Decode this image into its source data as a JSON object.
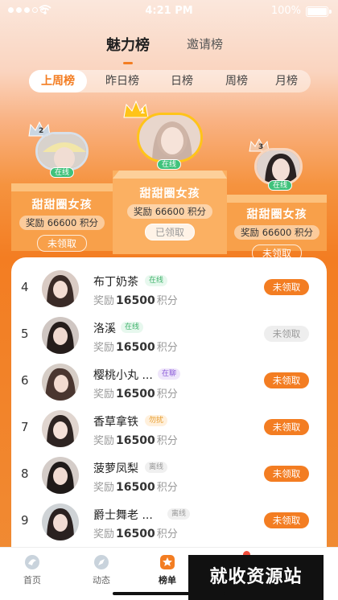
{
  "status_bar": {
    "time": "4:21 PM",
    "battery": "100%"
  },
  "top_tabs": [
    {
      "label": "魅力榜"
    },
    {
      "label": "邀请榜"
    }
  ],
  "period_tabs": [
    {
      "label": "上周榜"
    },
    {
      "label": "昨日榜"
    },
    {
      "label": "日榜"
    },
    {
      "label": "周榜"
    },
    {
      "label": "月榜"
    }
  ],
  "podium": {
    "first": {
      "rank": "1",
      "status": "在线",
      "name": "甜甜圈女孩",
      "reward": "奖励 66600 积分",
      "button": "已领取"
    },
    "second": {
      "rank": "2",
      "status": "在线",
      "name": "甜甜圈女孩",
      "reward": "奖励 66600 积分",
      "button": "未领取"
    },
    "third": {
      "rank": "3",
      "status": "在线",
      "name": "甜甜圈女孩",
      "reward": "奖励 66600 积分",
      "button": "未领取"
    }
  },
  "list": [
    {
      "rank": "4",
      "name": "布丁奶茶",
      "status": "在线",
      "status_type": "online",
      "reward_prefix": "奖励",
      "reward_value": "16500",
      "reward_unit": "积分",
      "button": "未领取",
      "claimed": false
    },
    {
      "rank": "5",
      "name": "洛溪",
      "status": "在线",
      "status_type": "online",
      "reward_prefix": "奖励",
      "reward_value": "16500",
      "reward_unit": "积分",
      "button": "未领取",
      "claimed": true
    },
    {
      "rank": "6",
      "name": "樱桃小丸 ...",
      "status": "在聊",
      "status_type": "room",
      "reward_prefix": "奖励",
      "reward_value": "16500",
      "reward_unit": "积分",
      "button": "未领取",
      "claimed": false
    },
    {
      "rank": "7",
      "name": "香草拿铁",
      "status": "勿扰",
      "status_type": "busy",
      "reward_prefix": "奖励",
      "reward_value": "16500",
      "reward_unit": "积分",
      "button": "未领取",
      "claimed": false
    },
    {
      "rank": "8",
      "name": "菠萝凤梨",
      "status": "离线",
      "status_type": "off",
      "reward_prefix": "奖励",
      "reward_value": "16500",
      "reward_unit": "积分",
      "button": "未领取",
      "claimed": false
    },
    {
      "rank": "9",
      "name": "爵士舞老 ...",
      "status": "离线",
      "status_type": "off",
      "reward_prefix": "奖励",
      "reward_value": "16500",
      "reward_unit": "积分",
      "button": "未领取",
      "claimed": false
    }
  ],
  "bottom_nav": [
    {
      "label": "首页",
      "icon": "home-icon"
    },
    {
      "label": "动态",
      "icon": "compass-icon"
    },
    {
      "label": "榜单",
      "icon": "star-icon"
    }
  ],
  "watermark": "就收资源站",
  "colors": {
    "accent": "#f37d22",
    "online": "#3fc27b"
  }
}
